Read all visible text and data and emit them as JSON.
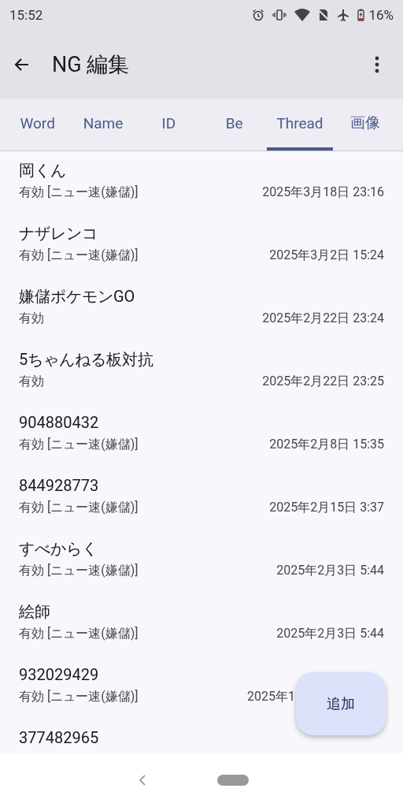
{
  "status_bar": {
    "time": "15:52",
    "battery": "16%"
  },
  "app_bar": {
    "title": "NG 編集"
  },
  "tabs": [
    {
      "label": "Word",
      "selected": false
    },
    {
      "label": "Name",
      "selected": false
    },
    {
      "label": "ID",
      "selected": false
    },
    {
      "label": "Be",
      "selected": false
    },
    {
      "label": "Thread",
      "selected": true
    },
    {
      "label": "画像",
      "selected": false
    }
  ],
  "items": [
    {
      "title": "岡くん",
      "status": "有効 [ニュー速(嫌儲)]",
      "date": "2025年3月18日 23:16"
    },
    {
      "title": "ナザレンコ",
      "status": "有効 [ニュー速(嫌儲)]",
      "date": "2025年3月2日 15:24"
    },
    {
      "title": "嫌儲ポケモンGO",
      "status": "有効",
      "date": "2025年2月22日 23:24"
    },
    {
      "title": "5ちゃんねる板対抗",
      "status": "有効",
      "date": "2025年2月22日 23:25"
    },
    {
      "title": "904880432",
      "status": "有効 [ニュー速(嫌儲)]",
      "date": "2025年2月8日 15:35"
    },
    {
      "title": "844928773",
      "status": "有効 [ニュー速(嫌儲)]",
      "date": "2025年2月15日 3:37"
    },
    {
      "title": "すべからく",
      "status": "有効 [ニュー速(嫌儲)]",
      "date": "2025年2月3日 5:44"
    },
    {
      "title": "絵師",
      "status": "有効 [ニュー速(嫌儲)]",
      "date": "2025年2月3日 5:44"
    },
    {
      "title": "932029429",
      "status": "有効 [ニュー速(嫌儲)]",
      "date": "2025年1",
      "covered": true
    },
    {
      "title": "377482965"
    }
  ],
  "fab": {
    "label": "追加"
  }
}
